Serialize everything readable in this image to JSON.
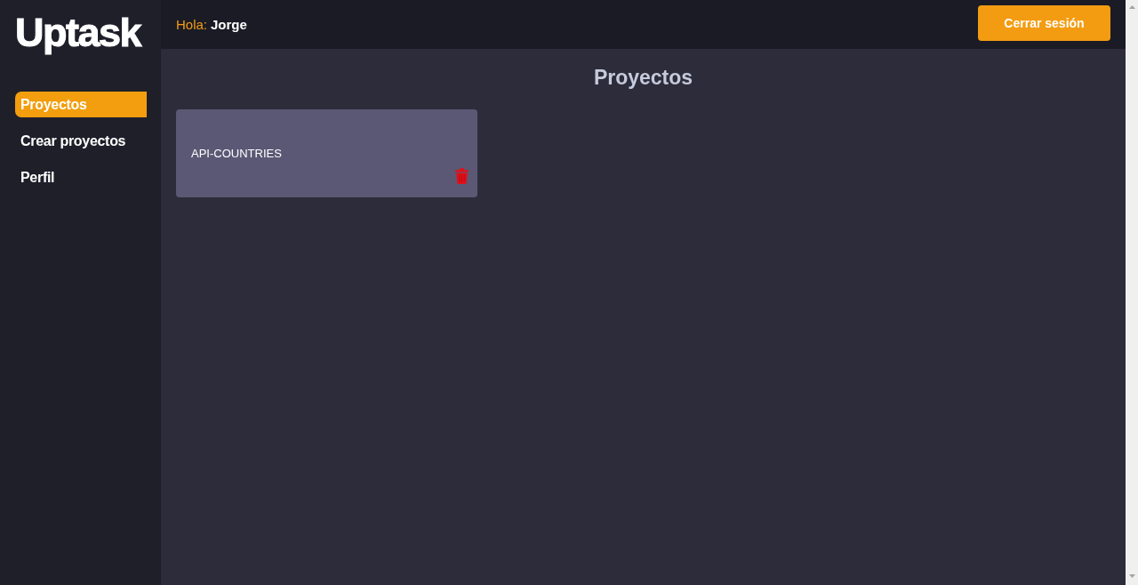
{
  "logo": "Uptask",
  "sidebar": {
    "items": [
      {
        "label": "Proyectos",
        "selected": true
      },
      {
        "label": "Crear proyectos",
        "selected": false
      },
      {
        "label": "Perfil",
        "selected": false
      }
    ]
  },
  "header": {
    "greeting": "Hola:",
    "user_name": "Jorge",
    "logout_button": "Cerrar sesión"
  },
  "main": {
    "title": "Proyectos",
    "projects": [
      {
        "name": "API-COUNTRIES"
      }
    ]
  }
}
